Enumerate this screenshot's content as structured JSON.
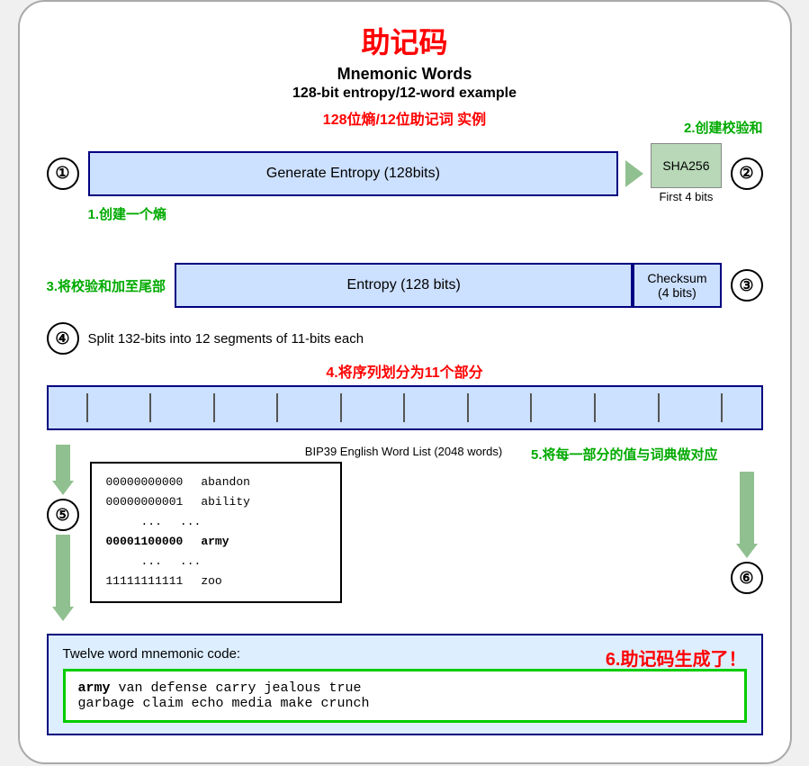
{
  "title_zh": "助记码",
  "title_en": "Mnemonic Words",
  "subtitle_en": "128-bit entropy/12-word example",
  "subtitle_zh": "128位熵/12位助记词 实例",
  "label_2": "2.创建校验和",
  "label_1": "1.创建一个熵",
  "label_3": "3.将校验和加至尾部",
  "label_4": "4.将序列划分为11个部分",
  "label_5": "5.将每一部分的值与词典做对应",
  "label_6": "6.助记码生成了！",
  "entropy_label": "Generate Entropy (128bits)",
  "sha_label": "SHA256",
  "first4bits": "First 4 bits",
  "entropy128_label": "Entropy (128 bits)",
  "checksum_label": "Checksum\n(4 bits)",
  "split_text": "Split 132-bits into 12 segments of 11-bits each",
  "circle1": "①",
  "circle2": "②",
  "circle3": "③",
  "circle4": "④",
  "circle5": "⑤",
  "circle6": "⑥",
  "bip_title": "BIP39 English Word List (2048 words)",
  "bip_rows": [
    {
      "binary": "00000000000",
      "word": "abandon"
    },
    {
      "binary": "00000000001",
      "word": "ability"
    },
    {
      "binary": "...",
      "word": "..."
    },
    {
      "binary": "00001100000",
      "word": "army",
      "bold": true
    },
    {
      "binary": "...",
      "word": "..."
    },
    {
      "binary": "11111111111",
      "word": "zoo"
    }
  ],
  "twelve_word_label": "Twelve word mnemonic code:",
  "mnemonic": "army van defense carry jealous true garbage claim echo media make crunch",
  "mnemonic_bold_word": "army"
}
